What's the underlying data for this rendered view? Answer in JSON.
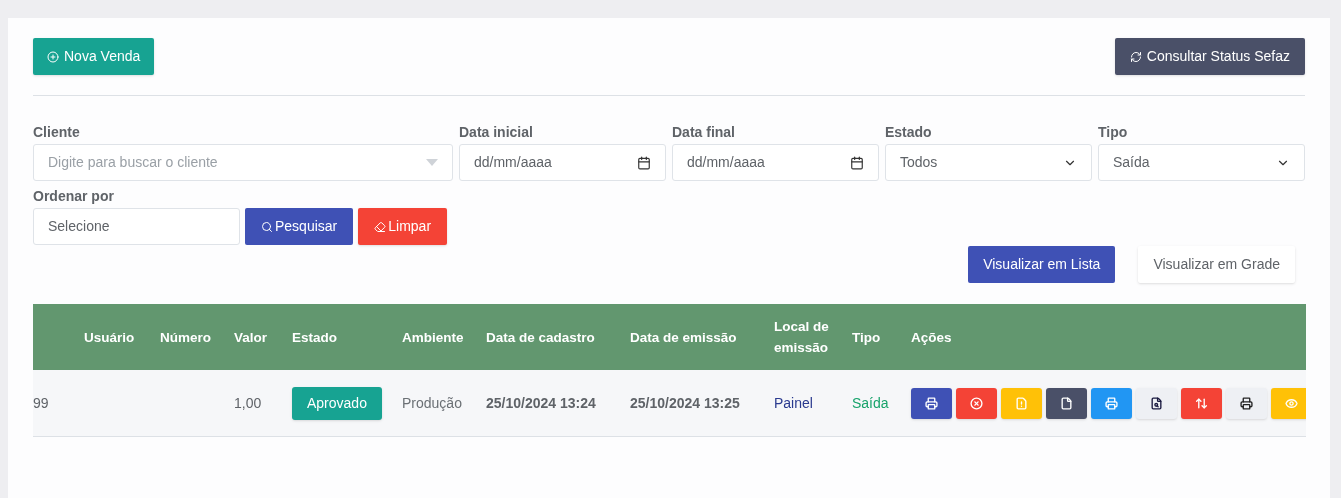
{
  "toolbar": {
    "new_button": "Nova Venda",
    "status_button": "Consultar Status Sefaz"
  },
  "filters": [
    {
      "label": "Cliente",
      "kind": "search",
      "placeholder": "Digite para buscar o cliente"
    },
    {
      "label": "Data inicial",
      "kind": "date",
      "placeholder": "dd/mm/aaaa"
    },
    {
      "label": "Data final",
      "kind": "date",
      "placeholder": "dd/mm/aaaa"
    },
    {
      "label": "Estado",
      "kind": "select",
      "value": "Todos"
    },
    {
      "label": "Tipo",
      "kind": "select",
      "value": "Saída"
    },
    {
      "label": "Ordenar por",
      "kind": "text",
      "value": "Selecione"
    }
  ],
  "search_button": "Pesquisar",
  "clear_button": "Limpar",
  "view_toggle": [
    {
      "label": "Visualizar em Lista",
      "selected": true
    },
    {
      "label": "Visualizar em Grade",
      "selected": false
    }
  ],
  "table": {
    "columns": [
      "",
      "Usuário",
      "Número",
      "Valor",
      "Estado",
      "Ambiente",
      "Data de cadastro",
      "Data de emissão",
      "Local de emissão",
      "Tipo",
      "Ações"
    ],
    "rows": [
      {
        "column_1": "99",
        "valor": "1,00",
        "estado": "Aprovado",
        "ambiente": "Produção",
        "data_cadastro": "25/10/2024 13:24",
        "data_emissao": "25/10/2024 13:25",
        "local": "Painel",
        "tipo": "Saída",
        "actions": [
          {
            "kind": "print",
            "color": "#3f51b5"
          },
          {
            "kind": "cancel",
            "color": "#f44336"
          },
          {
            "kind": "warning-doc",
            "color": "#ffc107"
          },
          {
            "kind": "doc",
            "color": "#4a5068"
          },
          {
            "kind": "print",
            "color": "#2196f3"
          },
          {
            "kind": "preview",
            "color": "#eef0f4"
          },
          {
            "kind": "swap",
            "color": "#f44336"
          },
          {
            "kind": "print-dark",
            "color": "#eef0f4"
          },
          {
            "kind": "view",
            "color": "#ffc107"
          }
        ]
      }
    ]
  }
}
